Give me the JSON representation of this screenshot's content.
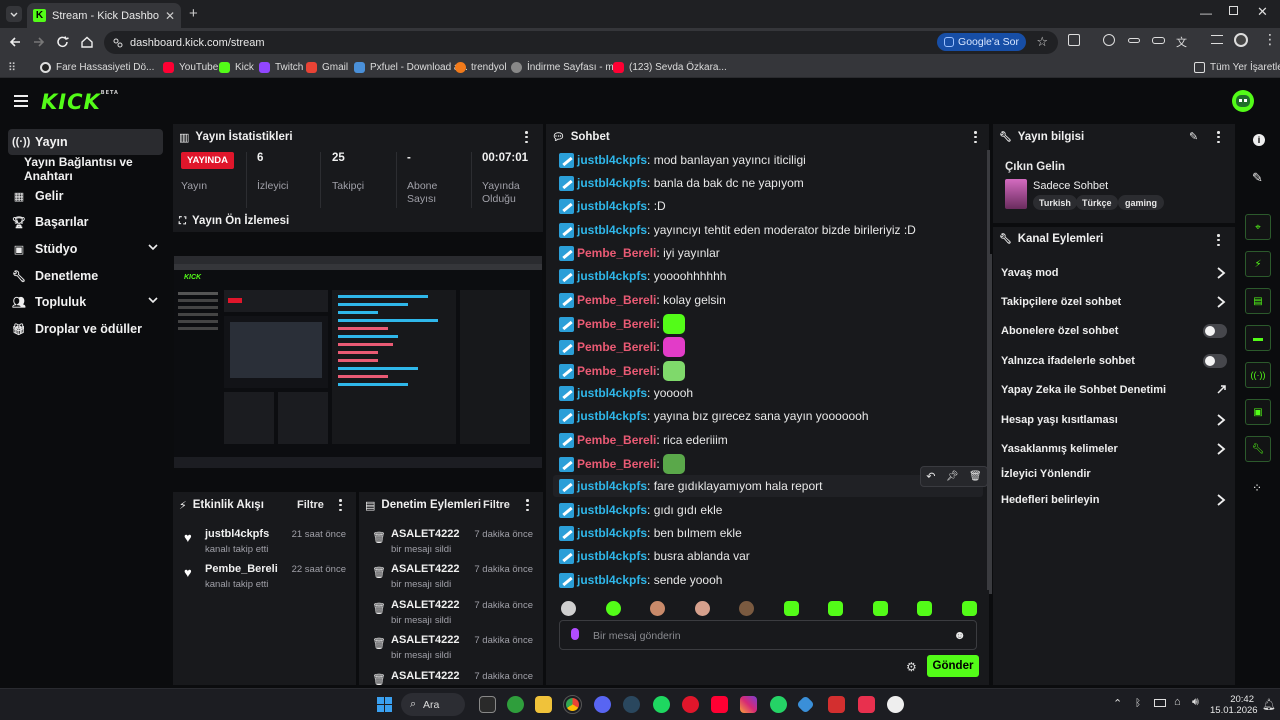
{
  "browser": {
    "tab_title": "Stream - Kick Dashboard",
    "url": "dashboard.kick.com/stream",
    "google_ask": "Google'a Sor",
    "bookmarks": [
      "Fare Hassasiyeti Dö...",
      "YouTube",
      "Kick",
      "Twitch",
      "Gmail",
      "Pxfuel - Download a...",
      "trendyol",
      "İndirme Sayfası - m...",
      "(123) Sevda Özkara..."
    ],
    "all_bookmarks": "Tüm Yer İşaretleri"
  },
  "kick": {
    "logo": "KICK",
    "logo_tag": "BETA"
  },
  "sidebar": {
    "items": [
      {
        "label": "Yayın"
      },
      {
        "label": "Yayın Bağlantısı ve Anahtarı"
      },
      {
        "label": "Gelir"
      },
      {
        "label": "Başarılar"
      },
      {
        "label": "Stüdyo"
      },
      {
        "label": "Denetleme"
      },
      {
        "label": "Topluluk"
      },
      {
        "label": "Droplar ve ödüller"
      }
    ]
  },
  "stats": {
    "title": "Yayın İstatistikleri",
    "live_badge": "YAYINDA",
    "live_label": "Yayın",
    "viewers_value": "6",
    "viewers_label": "İzleyici",
    "followers_value": "25",
    "followers_label": "Takipçi",
    "subs_value": "-",
    "subs_label": "Abone Sayısı",
    "duration_value": "00:07:01",
    "duration_label": "Yayında Olduğu"
  },
  "preview": {
    "title": "Yayın Ön İzlemesi"
  },
  "activity": {
    "title": "Etkinlik Akışı",
    "filter": "Filtre",
    "items": [
      {
        "name": "justbl4ckpfs",
        "sub": "kanalı takip etti",
        "time": "21 saat önce"
      },
      {
        "name": "Pembe_Bereli",
        "sub": "kanalı takip etti",
        "time": "22 saat önce"
      }
    ]
  },
  "moderation": {
    "title": "Denetim Eylemleri",
    "filter": "Filtre",
    "items": [
      {
        "name": "ASALET4222",
        "sub": "bir mesajı sildi",
        "time": "7 dakika önce"
      },
      {
        "name": "ASALET4222",
        "sub": "bir mesajı sildi",
        "time": "7 dakika önce"
      },
      {
        "name": "ASALET4222",
        "sub": "bir mesajı sildi",
        "time": "7 dakika önce"
      },
      {
        "name": "ASALET4222",
        "sub": "bir mesajı sildi",
        "time": "7 dakika önce"
      },
      {
        "name": "ASALET4222",
        "sub": "",
        "time": "7 dakika önce"
      }
    ]
  },
  "chat": {
    "title": "Sohbet",
    "messages": [
      {
        "user": "justbl4ckpfs",
        "text": "mod banlayan yayıncı iticiligi"
      },
      {
        "user": "justbl4ckpfs",
        "text": "banla da bak dc ne yapıyom"
      },
      {
        "user": "justbl4ckpfs",
        "text": ":D"
      },
      {
        "user": "justbl4ckpfs",
        "text": "yayıncıyı tehtit eden moderator bizde birileriyiz :D"
      },
      {
        "user": "Pembe_Bereli",
        "text": "iyi yayınlar"
      },
      {
        "user": "justbl4ckpfs",
        "text": "yoooohhhhhh"
      },
      {
        "user": "Pembe_Bereli",
        "text": "kolay gelsin"
      },
      {
        "user": "Pembe_Bereli",
        "text": ""
      },
      {
        "user": "Pembe_Bereli",
        "text": ""
      },
      {
        "user": "Pembe_Bereli",
        "text": ""
      },
      {
        "user": "justbl4ckpfs",
        "text": "yooooh"
      },
      {
        "user": "justbl4ckpfs",
        "text": "yayına bız gırecez sana yayın yooooooh"
      },
      {
        "user": "Pembe_Bereli",
        "text": "rica ederiiim"
      },
      {
        "user": "Pembe_Bereli",
        "text": ""
      },
      {
        "user": "justbl4ckpfs",
        "text": "fare gıdıklayamıyom hala report"
      },
      {
        "user": "justbl4ckpfs",
        "text": "gıdı gıdı ekle"
      },
      {
        "user": "justbl4ckpfs",
        "text": "ben bılmem ekle"
      },
      {
        "user": "justbl4ckpfs",
        "text": "busra ablanda var"
      },
      {
        "user": "justbl4ckpfs",
        "text": "sende yoooh"
      }
    ],
    "input_placeholder": "Bir mesaj gönderin",
    "send": "Gönder"
  },
  "info": {
    "title": "Yayın bilgisi",
    "stream_title": "Çıkın Gelin",
    "category": "Sadece Sohbet",
    "tags": [
      "Turkish",
      "Türkçe",
      "gaming"
    ]
  },
  "channel": {
    "title": "Kanal Eylemleri",
    "rows": [
      {
        "label": "Yavaş mod",
        "ctrl": "chev"
      },
      {
        "label": "Takipçilere özel sohbet",
        "ctrl": "chev"
      },
      {
        "label": "Abonelere özel sohbet",
        "ctrl": "toggle"
      },
      {
        "label": "Yalnızca ifadelerle sohbet",
        "ctrl": "toggle"
      },
      {
        "label": "Yapay Zeka ile Sohbet Denetimi",
        "ctrl": "ext"
      },
      {
        "label": "Hesap yaşı kısıtlaması",
        "ctrl": "chev"
      },
      {
        "label": "Yasaklanmış kelimeler",
        "ctrl": "chev"
      },
      {
        "label": "İzleyici Yönlendir",
        "ctrl": "none"
      },
      {
        "label": "Hedefleri belirleyin",
        "ctrl": "chev"
      }
    ]
  },
  "taskbar": {
    "search": "Ara",
    "time": "20:42",
    "date": "15.01.2026"
  },
  "colors": {
    "accent": "#53fc18",
    "live": "#e0162b",
    "user1": "#2fb7ea",
    "user2": "#ea5a74",
    "panel": "#18191c"
  }
}
